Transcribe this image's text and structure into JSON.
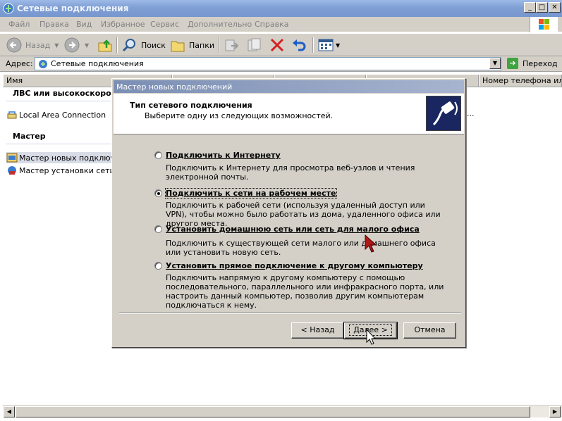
{
  "window": {
    "title": "Сетевые подключения",
    "controls": {
      "minimize": "_",
      "maximize": "□",
      "close": "✕"
    }
  },
  "menu": [
    "Файл",
    "Правка",
    "Вид",
    "Избранное",
    "Сервис",
    "Дополнительно",
    "Справка"
  ],
  "toolbar": {
    "back_label": "Назад",
    "search_label": "Поиск",
    "folders_label": "Папки"
  },
  "address": {
    "label": "Адрес:",
    "value": "Сетевые подключения",
    "go_label": "Переход"
  },
  "columns": {
    "name": "Имя",
    "phone": "Номер телефона или а"
  },
  "groups": {
    "lan": "ЛВС или высокоскорост",
    "wizard": "Мастер"
  },
  "items": {
    "lan_connection": "Local Area Connection",
    "lan_ellipsis": "...",
    "new_connection_wizard": "Мастер новых подключе",
    "network_setup_wizard": "Мастер установки сети"
  },
  "dialog": {
    "title": "Мастер новых подключений",
    "header_title": "Тип сетевого подключения",
    "header_subtitle": "Выберите одну из следующих возможностей.",
    "options": [
      {
        "title": "Подключить к Интернету",
        "desc": "Подключить к Интернету для просмотра веб-узлов и чтения  электронной почты.",
        "selected": false
      },
      {
        "title": "Подключить к сети на рабочем месте",
        "desc": "Подключить к рабочей сети (используя удаленный доступ или VPN), чтобы можно было работать из дома, удаленного офиса или другого места.",
        "selected": true
      },
      {
        "title": "Установить домашнюю сеть или сеть для малого офиса",
        "desc": "Подключить к существующей сети малого или домашнего офиса или установить новую сеть.",
        "selected": false
      },
      {
        "title": "Установить прямое подключение к другому компьютеру",
        "desc": "Подключить напрямую к другому компьютеру с помощью последовательного, параллельного или инфракрасного порта, или настроить данный компьютер, позволив другим  компьютерам подключаться к нему.",
        "selected": false
      }
    ],
    "buttons": {
      "back": "< Назад",
      "next": "Далее >",
      "cancel": "Отмена"
    }
  },
  "colors": {
    "titlebar": "#7f9fd4",
    "dialog_bg": "#d4d0c8",
    "icon_bg": "#1a2660"
  }
}
